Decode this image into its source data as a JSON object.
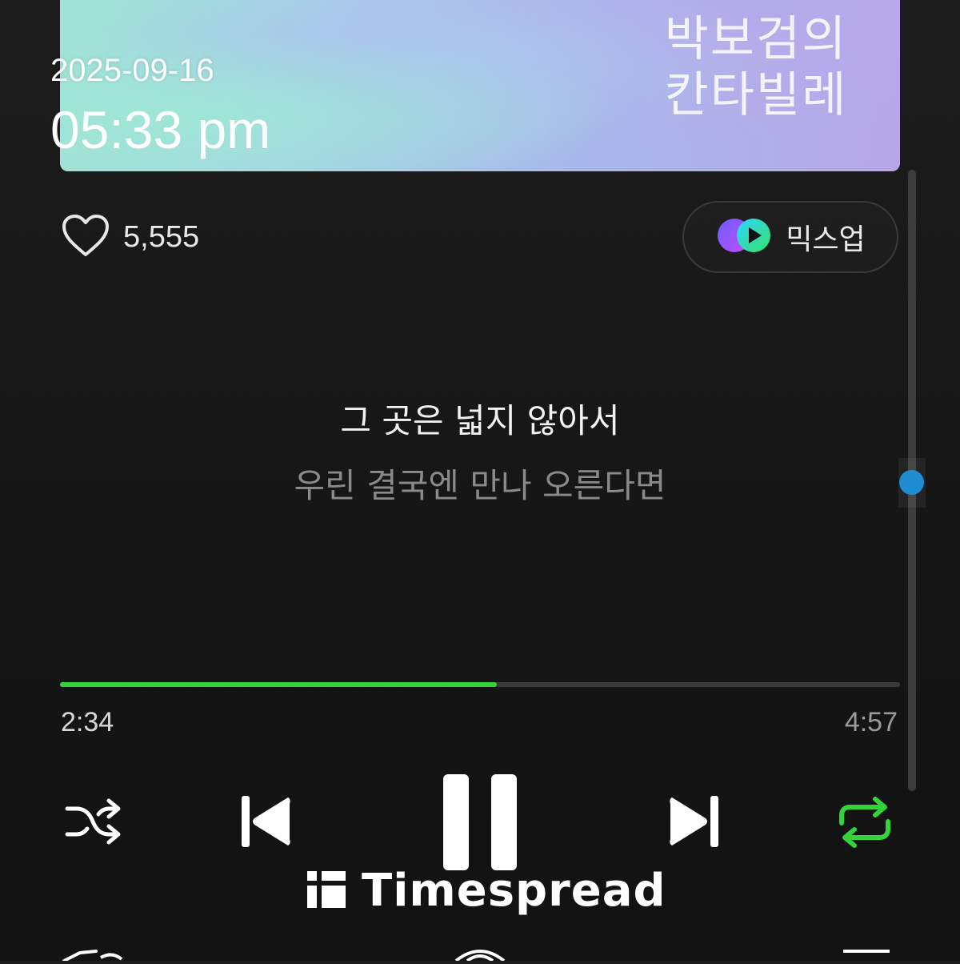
{
  "overlay": {
    "date": "2025-09-16",
    "time": "05:33 pm"
  },
  "album": {
    "title": "박보검의 칸타빌레"
  },
  "likes": {
    "count": "5,555",
    "icon": "heart-outline-icon"
  },
  "mixup": {
    "label": "믹스업",
    "icon": "mixup-logo-icon"
  },
  "lyrics": {
    "current": "그 곳은 넓지 않아서",
    "next": "우린 결국엔 만나 오른다면"
  },
  "playback": {
    "elapsed": "2:34",
    "total": "4:57",
    "progress_fraction": 0.52,
    "accent_color": "#35d33a"
  },
  "controls": {
    "shuffle": "shuffle-icon",
    "previous": "skip-previous-icon",
    "pause": "pause-icon",
    "next": "skip-next-icon",
    "repeat": "repeat-icon",
    "repeat_active_color": "#35d33a"
  },
  "watermark": {
    "text": "Timespread"
  }
}
